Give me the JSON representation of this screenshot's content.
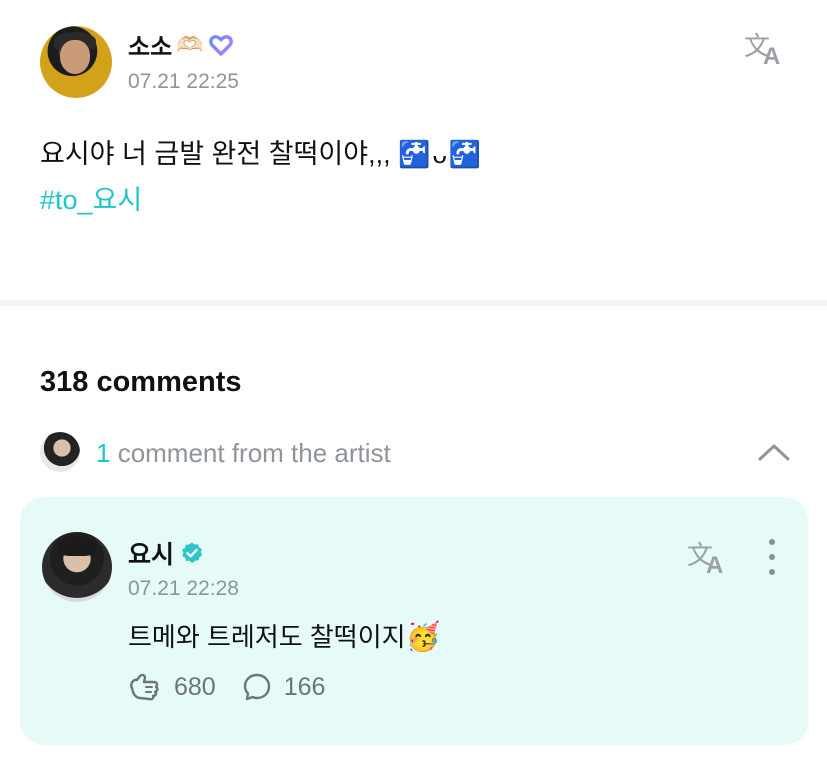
{
  "post": {
    "author": {
      "name": "소소",
      "emoji": "🫶🏻"
    },
    "timestamp": "07.21 22:25",
    "text": "요시야 너 금발 완전 찰떡이야,,, ",
    "text_emoji": "🚰ᴗ🚰",
    "hashtag": "#to_요시"
  },
  "comments": {
    "count_label": "318 comments",
    "artist_summary": {
      "count": "1",
      "label": " comment from the artist"
    },
    "artist_comment": {
      "author": "요시",
      "timestamp": "07.21 22:28",
      "text": "트메와 트레저도 찰떡이지",
      "text_emoji": "🥳",
      "likes": "680",
      "replies": "166"
    }
  },
  "colors": {
    "accent": "#1fc6c8",
    "card_background": "#e6faf8",
    "muted_text": "#8e9499",
    "membership_gradient": [
      "#6a8cff",
      "#b07cff"
    ],
    "verified": "#2ec4c9"
  },
  "icons": [
    "heart-hands-icon",
    "membership-heart-icon",
    "translate-icon",
    "chevron-up-icon",
    "verified-badge-icon",
    "more-icon",
    "like-icon",
    "reply-icon"
  ]
}
